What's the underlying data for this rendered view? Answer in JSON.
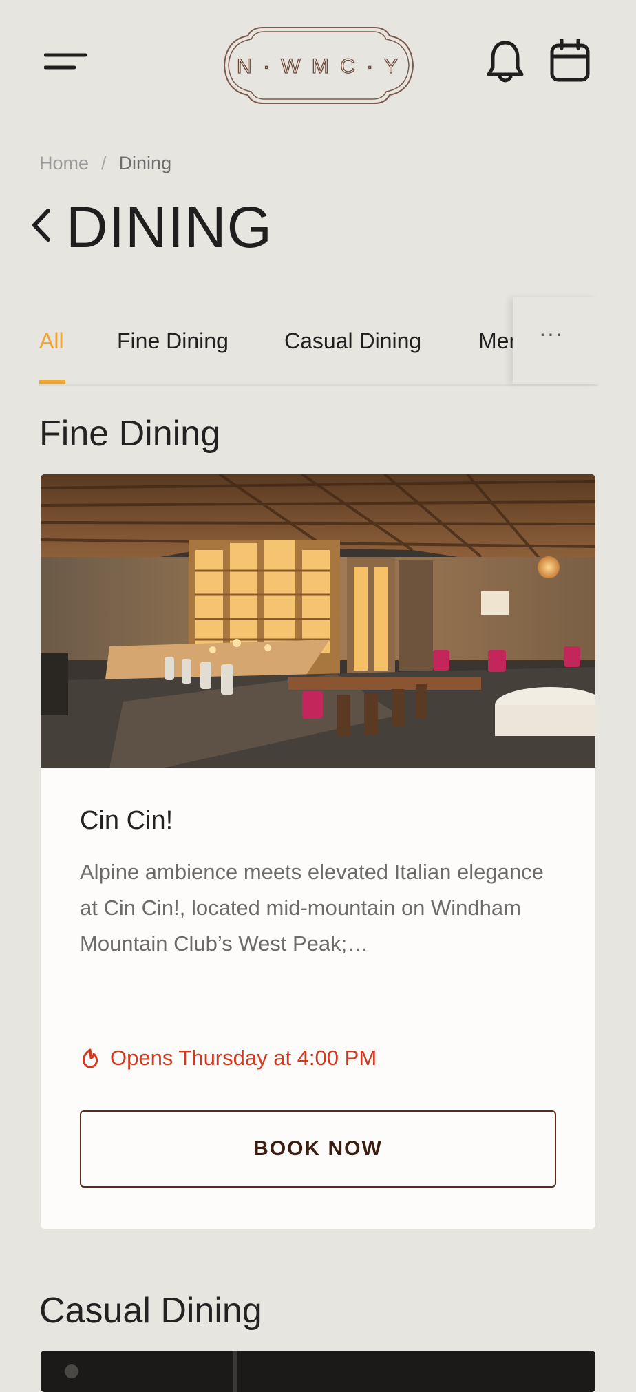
{
  "header": {
    "logo_text": "N · W M C · Y",
    "menu_icon": "hamburger-menu-icon",
    "notification_icon": "bell-icon",
    "calendar_icon": "calendar-icon"
  },
  "breadcrumb": {
    "home": "Home",
    "separator": "/",
    "current": "Dining"
  },
  "page": {
    "title": "DINING",
    "back_icon": "chevron-left-icon"
  },
  "tabs": {
    "items": [
      {
        "label": "All",
        "active": true
      },
      {
        "label": "Fine Dining",
        "active": false
      },
      {
        "label": "Casual Dining",
        "active": false
      },
      {
        "label": "Mem",
        "active": false
      }
    ],
    "more_label": "···",
    "active_color": "#efa52f"
  },
  "sections": [
    {
      "heading": "Fine Dining",
      "venue": {
        "name": "Cin Cin!",
        "description": "Alpine ambience meets elevated Italian elegance at Cin Cin!, located mid-mountain on Windham Mountain Club’s West Peak;…",
        "status": "Opens Thursday at 4:00 PM",
        "status_color": "#d0391f",
        "status_icon": "flame-icon",
        "button_label": "BOOK NOW"
      }
    },
    {
      "heading": "Casual Dining"
    }
  ]
}
